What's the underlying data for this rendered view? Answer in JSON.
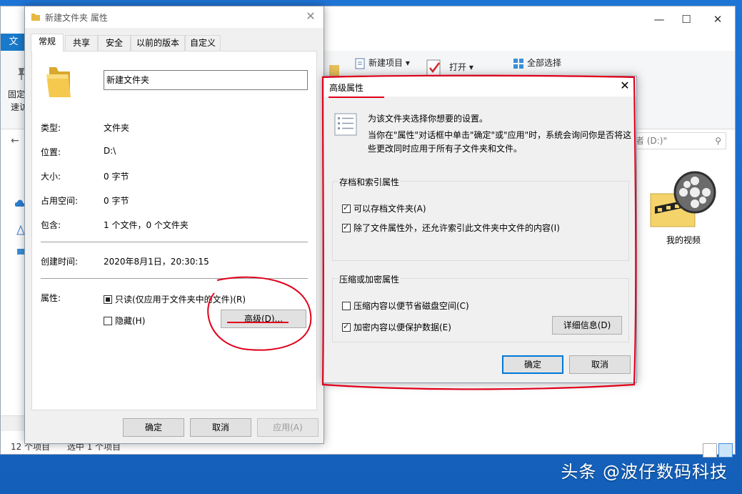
{
  "explorer": {
    "ribbon_tab": "文",
    "ribbon_left_top": "固定",
    "ribbon_left_bottom": "速访",
    "new_item": "新建项目",
    "open": "打开",
    "select_all": "全部选择",
    "search_placeholder": "者 (D:)\"",
    "status_items": "12 个项目",
    "status_selected": "选中 1 个项目",
    "video_folder_label": "我的视频",
    "minimize_glyph": "—",
    "maximize_glyph": "☐",
    "close_glyph": "✕"
  },
  "properties": {
    "title": "新建文件夹 属性",
    "close_glyph": "✕",
    "tabs": [
      "常规",
      "共享",
      "安全",
      "以前的版本",
      "自定义"
    ],
    "folder_name": "新建文件夹",
    "rows": [
      {
        "label": "类型:",
        "value": "文件夹"
      },
      {
        "label": "位置:",
        "value": "D:\\"
      },
      {
        "label": "大小:",
        "value": "0 字节"
      },
      {
        "label": "占用空间:",
        "value": "0 字节"
      },
      {
        "label": "包含:",
        "value": "1 个文件，0 个文件夹"
      }
    ],
    "created_label": "创建时间:",
    "created_value": "2020年8月1日，20:30:15",
    "attributes_label": "属性:",
    "readonly_label": "只读(仅应用于文件夹中的文件)(R)",
    "hidden_label": "隐藏(H)",
    "advanced_button": "高级(D)...",
    "ok": "确定",
    "cancel": "取消",
    "apply": "应用(A)"
  },
  "advanced": {
    "title": "高级属性",
    "close_glyph": "✕",
    "intro_line1": "为该文件夹选择你想要的设置。",
    "intro_line2": "当你在\"属性\"对话框中单击\"确定\"或\"应用\"时，系统会询问你是否将这",
    "intro_line3": "些更改同时应用于所有子文件夹和文件。",
    "archive_group": "存档和索引属性",
    "archive_label": "可以存档文件夹(A)",
    "index_label": "除了文件属性外，还允许索引此文件夹中文件的内容(I)",
    "compress_group": "压缩或加密属性",
    "compress_label": "压缩内容以便节省磁盘空间(C)",
    "encrypt_label": "加密内容以便保护数据(E)",
    "details_button": "详细信息(D)",
    "ok": "确定",
    "cancel": "取消"
  },
  "watermark": "头条 @波仔数码科技",
  "colors": {
    "accent": "#0078d7",
    "annotation": "#e0001b",
    "desktop": "#1a6ccd"
  }
}
